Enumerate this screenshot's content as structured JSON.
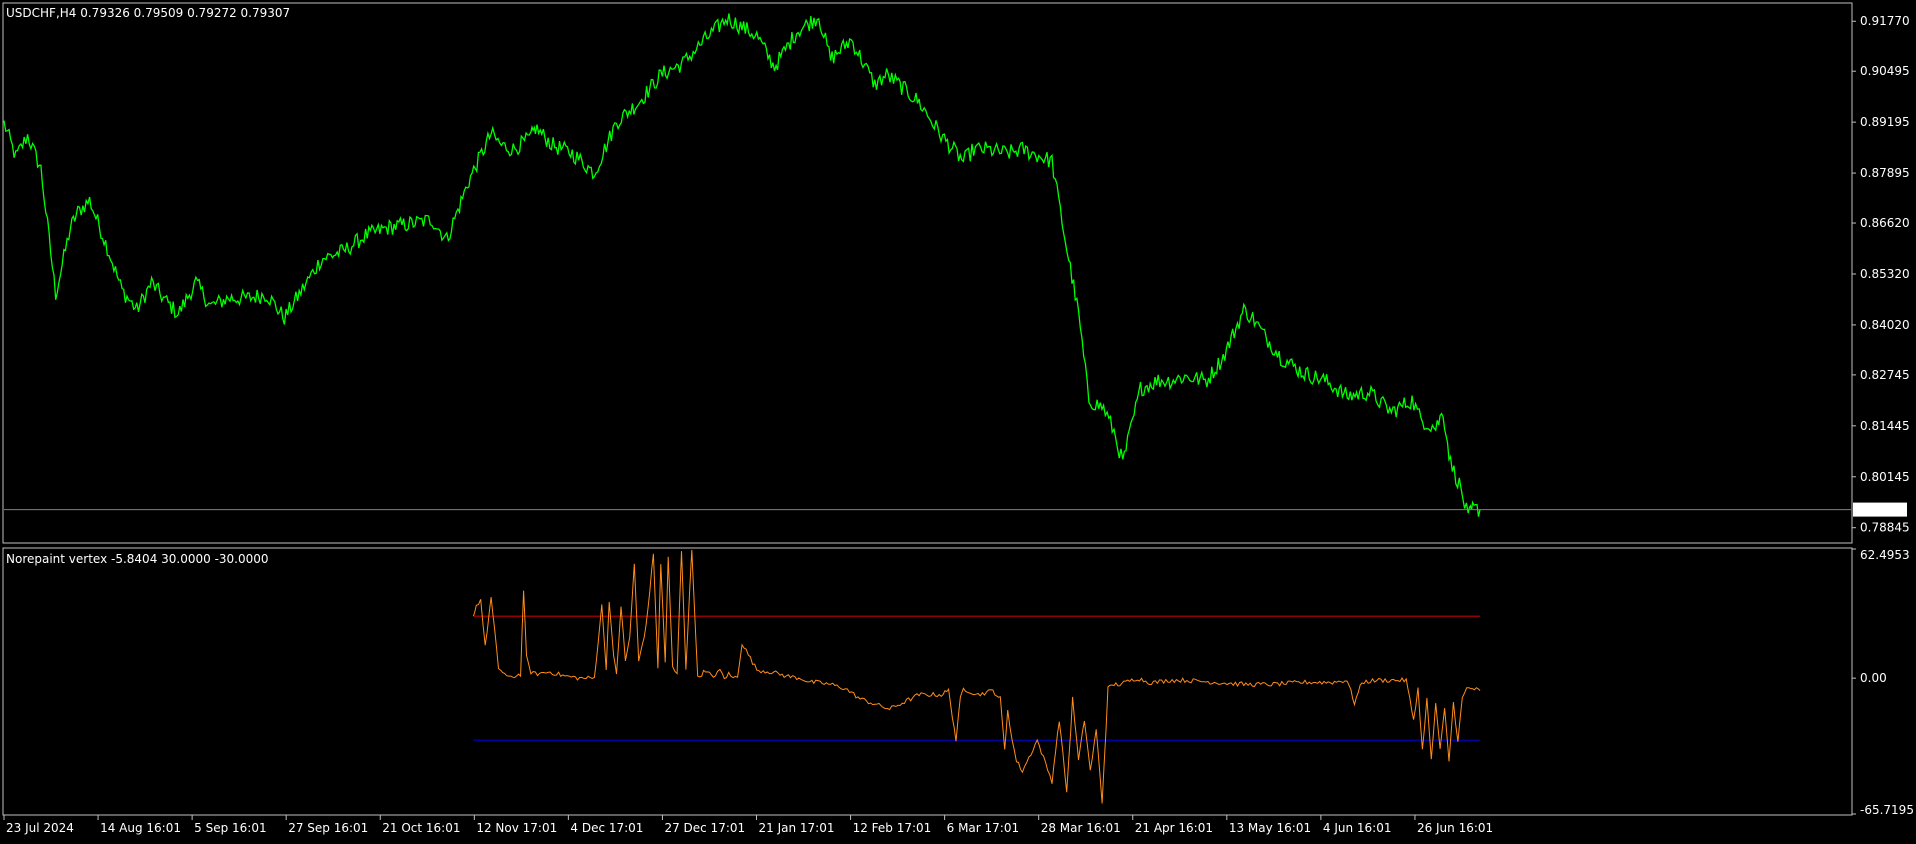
{
  "colors": {
    "background": "#000000",
    "frame": "#c0c0c0",
    "price_line": "#00ff00",
    "oscillator_line": "#ff8c1a",
    "upper_level": "#c00000",
    "lower_level": "#0000d0",
    "current_price_line": "#808080",
    "price_box_bg": "#ffffff",
    "price_box_text": "#000000"
  },
  "main_panel": {
    "title": "USDCHF,H4  0.79326 0.79509 0.79272 0.79307",
    "current_price": "0.79307",
    "current_price_value": 0.79307
  },
  "indicator_panel": {
    "title": "Norepaint vertex -5.8404 30.0000 -30.0000"
  },
  "chart_data": [
    {
      "type": "line",
      "title": "USDCHF,H4  0.79326 0.79509 0.79272 0.79307",
      "series": [
        {
          "name": "USDCHF,H4",
          "x": [
            0,
            0.008,
            0.016,
            0.025,
            0.035,
            0.045,
            0.05,
            0.058,
            0.07,
            0.08,
            0.09,
            0.1,
            0.108,
            0.118,
            0.13,
            0.14,
            0.152,
            0.165,
            0.178,
            0.19,
            0.2,
            0.215,
            0.23,
            0.245,
            0.26,
            0.275,
            0.29,
            0.3,
            0.315,
            0.33,
            0.337,
            0.345,
            0.357,
            0.36,
            0.372,
            0.385,
            0.4,
            0.415,
            0.43,
            0.445,
            0.46,
            0.475,
            0.49,
            0.51,
            0.522,
            0.537,
            0.552,
            0.56,
            0.574,
            0.59,
            0.598,
            0.605,
            0.62,
            0.636,
            0.65,
            0.657,
            0.665,
            0.68,
            0.69,
            0.71,
            0.718,
            0.728,
            0.735,
            0.745,
            0.752,
            0.758,
            0.77,
            0.782,
            0.79,
            0.8,
            0.815,
            0.826,
            0.84,
            0.846,
            0.853,
            0.865,
            0.88,
            0.895,
            0.91,
            0.925,
            0.94,
            0.954,
            0.96,
            0.97,
            0.975,
            0.98,
            0.986,
            0.992,
            0.995,
            1.0
          ],
          "values": [
            0.8917,
            0.883,
            0.8885,
            0.88,
            0.848,
            0.865,
            0.869,
            0.872,
            0.86,
            0.849,
            0.844,
            0.851,
            0.847,
            0.843,
            0.851,
            0.845,
            0.847,
            0.847,
            0.848,
            0.842,
            0.848,
            0.857,
            0.859,
            0.863,
            0.865,
            0.866,
            0.867,
            0.862,
            0.877,
            0.889,
            0.886,
            0.885,
            0.888,
            0.8905,
            0.886,
            0.884,
            0.879,
            0.892,
            0.897,
            0.904,
            0.907,
            0.913,
            0.9185,
            0.914,
            0.906,
            0.915,
            0.919,
            0.908,
            0.913,
            0.9015,
            0.904,
            0.902,
            0.897,
            0.888,
            0.882,
            0.885,
            0.885,
            0.884,
            0.885,
            0.882,
            0.864,
            0.843,
            0.821,
            0.819,
            0.813,
            0.805,
            0.824,
            0.826,
            0.826,
            0.827,
            0.826,
            0.832,
            0.844,
            0.842,
            0.838,
            0.832,
            0.828,
            0.826,
            0.822,
            0.823,
            0.818,
            0.821,
            0.816,
            0.814,
            0.818,
            0.805,
            0.7995,
            0.791,
            0.7932,
            0.7931
          ]
        }
      ],
      "xlabels": [
        "23 Jul 2024",
        "14 Aug 16:01",
        "5 Sep 16:01",
        "27 Sep 16:01",
        "21 Oct 16:01",
        "12 Nov 17:01",
        "4 Dec 17:01",
        "27 Dec 17:01",
        "21 Jan 17:01",
        "12 Feb 17:01",
        "6 Mar 17:01",
        "28 Mar 16:01",
        "21 Apr 16:01",
        "13 May 16:01",
        "4 Jun 16:01",
        "26 Jun 16:01"
      ],
      "yticks": [
        "0.91770",
        "0.90495",
        "0.89195",
        "0.87895",
        "0.86620",
        "0.85320",
        "0.84020",
        "0.82745",
        "0.81445",
        "0.80145",
        "0.78845"
      ],
      "ylim": [
        0.7848,
        0.9221
      ]
    },
    {
      "type": "line",
      "title": "Norepaint vertex -5.8404 30.0000 -30.0000",
      "series": [
        {
          "name": "Norepaint vertex",
          "x": [
            0.318,
            0.32,
            0.323,
            0.326,
            0.33,
            0.335,
            0.342,
            0.35,
            0.352,
            0.354,
            0.357,
            0.36,
            0.37,
            0.38,
            0.39,
            0.4,
            0.405,
            0.408,
            0.41,
            0.413,
            0.415,
            0.418,
            0.421,
            0.424,
            0.427,
            0.43,
            0.435,
            0.44,
            0.443,
            0.445,
            0.448,
            0.45,
            0.453,
            0.456,
            0.459,
            0.462,
            0.466,
            0.47,
            0.474,
            0.478,
            0.482,
            0.485,
            0.488,
            0.491,
            0.494,
            0.497,
            0.5,
            0.51,
            0.52,
            0.53,
            0.54,
            0.543,
            0.546,
            0.55,
            0.56,
            0.57,
            0.58,
            0.6,
            0.62,
            0.635,
            0.64,
            0.645,
            0.648,
            0.65,
            0.66,
            0.67,
            0.675,
            0.678,
            0.68,
            0.683,
            0.686,
            0.69,
            0.7,
            0.71,
            0.715,
            0.72,
            0.724,
            0.728,
            0.732,
            0.736,
            0.74,
            0.744,
            0.748,
            0.752,
            0.756,
            0.76,
            0.764,
            0.768,
            0.772,
            0.775,
            0.78,
            0.79,
            0.8,
            0.82,
            0.84,
            0.86,
            0.88,
            0.9,
            0.91,
            0.915,
            0.92,
            0.93,
            0.94,
            0.95,
            0.955,
            0.958,
            0.961,
            0.964,
            0.967,
            0.97,
            0.973,
            0.976,
            0.979,
            0.982,
            0.985,
            0.988,
            0.991,
            0.995,
            1.0
          ],
          "values": [
            30,
            35,
            38,
            15,
            39,
            5,
            0,
            2,
            43,
            10,
            3,
            2,
            3,
            1,
            0,
            0,
            35,
            5,
            38,
            10,
            2,
            35,
            8,
            20,
            55,
            8,
            25,
            60,
            5,
            55,
            8,
            58,
            5,
            2,
            62,
            5,
            62,
            0,
            3,
            2,
            1,
            4,
            0,
            2,
            0,
            1,
            17,
            4,
            3,
            1,
            0,
            -1,
            -2,
            -2,
            -3,
            -5,
            -10,
            -15,
            -8,
            -8,
            -6,
            -30,
            -10,
            -5,
            -8,
            -6,
            -10,
            -35,
            -15,
            -30,
            -40,
            -45,
            -30,
            -50,
            -20,
            -55,
            -10,
            -40,
            -20,
            -45,
            -25,
            -60,
            -5,
            -3,
            -3,
            -2,
            -1,
            0,
            -1,
            -2,
            -2,
            -1,
            -1,
            -2,
            -3,
            -3,
            -2,
            -2,
            -1,
            -12,
            -2,
            -1,
            -1,
            -1,
            -20,
            -5,
            -35,
            -10,
            -40,
            -12,
            -35,
            -15,
            -40,
            -12,
            -30,
            -10,
            -5,
            -5,
            -6
          ],
          "y_unit": "oscillator"
        }
      ],
      "levels": [
        30,
        -30
      ],
      "yticks": [
        "62.4953",
        "0.00",
        "-65.7195"
      ],
      "ylim": [
        -65.7195,
        62.4953
      ]
    }
  ]
}
